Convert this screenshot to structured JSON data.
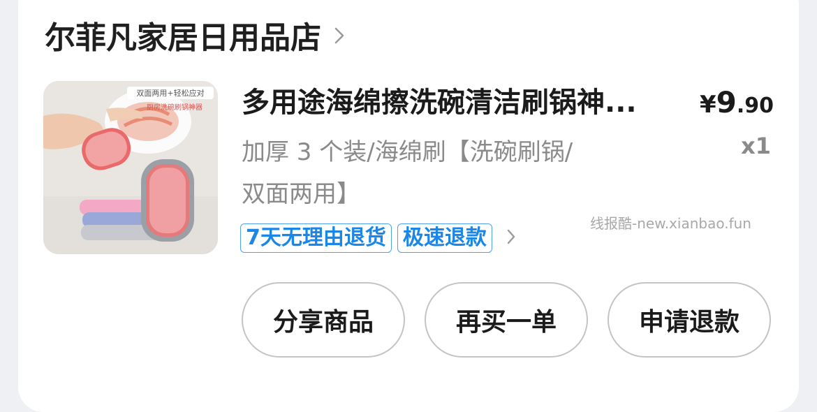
{
  "shop": {
    "name": "尔菲凡家居日用品店"
  },
  "product": {
    "title": "多用途海绵擦洗碗清洁刷锅神...",
    "price": {
      "symbol": "¥",
      "integer": "9",
      "decimal": ".90"
    },
    "variant": "加厚 3 个装/海绵刷【洗碗刷锅/双面两用】",
    "quantity": "x1",
    "image_texts": {
      "badge": "双面两用+轻松应对",
      "caption": "厨房洗碗刷锅神器"
    }
  },
  "tags": [
    "7天无理由退货",
    "极速退款"
  ],
  "watermark": "线报酷-new.xianbao.fun",
  "actions": {
    "share": "分享商品",
    "rebuy": "再买一单",
    "refund": "申请退款"
  },
  "colors": {
    "tag_blue": "#1a86e6",
    "text_primary": "#1b1b1b",
    "text_secondary": "#8a8a8a",
    "border": "#c4c4c4"
  },
  "icons": {
    "shop_arrow": "chevron-right-icon",
    "tag_arrow": "chevron-right-icon"
  }
}
